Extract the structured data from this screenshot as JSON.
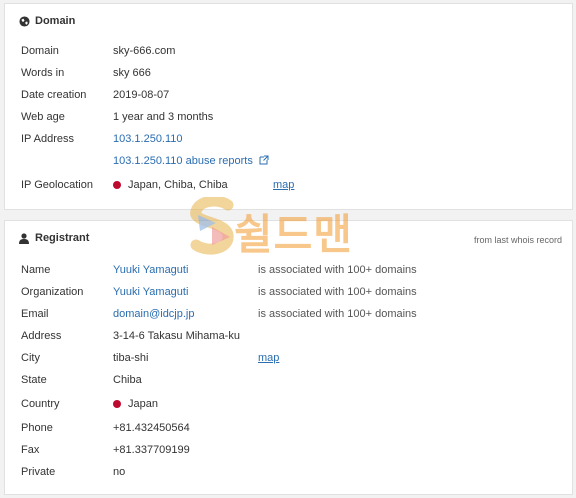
{
  "domain_section": {
    "title": "Domain",
    "rows": {
      "domain": {
        "label": "Domain",
        "value": "sky-666.com"
      },
      "words": {
        "label": "Words in",
        "value": "sky 666"
      },
      "date_creation": {
        "label": "Date creation",
        "value": "2019-08-07"
      },
      "web_age": {
        "label": "Web age",
        "value": "1 year and 3 months"
      },
      "ip_address": {
        "label": "IP Address",
        "value": "103.1.250.110",
        "abuse_link": "103.1.250.110 abuse reports"
      },
      "ip_geolocation": {
        "label": "IP Geolocation",
        "value": "Japan, Chiba, Chiba",
        "map": "map"
      }
    }
  },
  "registrant_section": {
    "title": "Registrant",
    "note": "from last whois record",
    "rows": {
      "name": {
        "label": "Name",
        "value": "Yuuki Yamaguti",
        "assoc": "is associated with 100+ domains"
      },
      "organization": {
        "label": "Organization",
        "value": "Yuuki Yamaguti",
        "assoc": "is associated with 100+ domains"
      },
      "email": {
        "label": "Email",
        "value": "domain@idcjp.jp",
        "assoc": "is associated with 100+ domains"
      },
      "address": {
        "label": "Address",
        "value": "3-14-6 Takasu Mihama-ku"
      },
      "city": {
        "label": "City",
        "value": "tiba-shi",
        "map": "map"
      },
      "state": {
        "label": "State",
        "value": "Chiba"
      },
      "country": {
        "label": "Country",
        "value": "Japan"
      },
      "phone": {
        "label": "Phone",
        "value": "+81.432450564"
      },
      "fax": {
        "label": "Fax",
        "value": "+81.337709199"
      },
      "private": {
        "label": "Private",
        "value": "no"
      }
    }
  },
  "watermark": {
    "text": "쉴드맨"
  },
  "colors": {
    "link": "#2a6db0",
    "flag_dot": "#bf0a30",
    "watermark": "#f29a2e"
  }
}
